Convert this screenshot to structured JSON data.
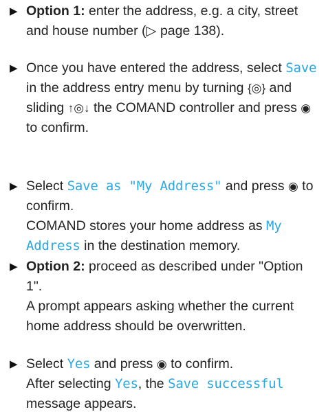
{
  "doc": {
    "bullet_symbol": "▶",
    "step1": {
      "label": "Option 1:",
      "text_a": " enter the address, e.g. a city, street and house number (",
      "ref_symbol": "▷",
      "text_b": " page 138)."
    },
    "step2": {
      "text_a": "Once you have entered the address, select ",
      "save": "Save",
      "text_b": " in the address entry menu by turning ",
      "turn_symbol": "{◎}",
      "text_c": " and sliding ",
      "slide_symbol": "↑◎↓",
      "text_d": " the COMAND controller and press ",
      "press_symbol": "◉",
      "text_e": " to confirm."
    },
    "step3": {
      "text_a": "Select ",
      "save_as": "Save as \"My Address\"",
      "text_b": " and press ",
      "press_symbol": "◉",
      "text_c": " to confirm.",
      "text_d": "COMAND stores your home address as ",
      "my_address": "My Address",
      "text_e": " in the destination memory."
    },
    "step4": {
      "label": "Option 2:",
      "text_a": " proceed as described under \"Option 1\".",
      "text_b": "A prompt appears asking whether the current home address should be overwritten."
    },
    "step5": {
      "text_a": "Select ",
      "yes": "Yes",
      "text_b": " and press ",
      "press_symbol": "◉",
      "text_c": " to confirm.",
      "text_d": "After selecting ",
      "yes2": "Yes",
      "text_e": ", the ",
      "save_successful": "Save successful",
      "text_f": " message appears."
    },
    "colors": {
      "display_text": "#2aa8e0",
      "body_text": "#222222"
    }
  }
}
